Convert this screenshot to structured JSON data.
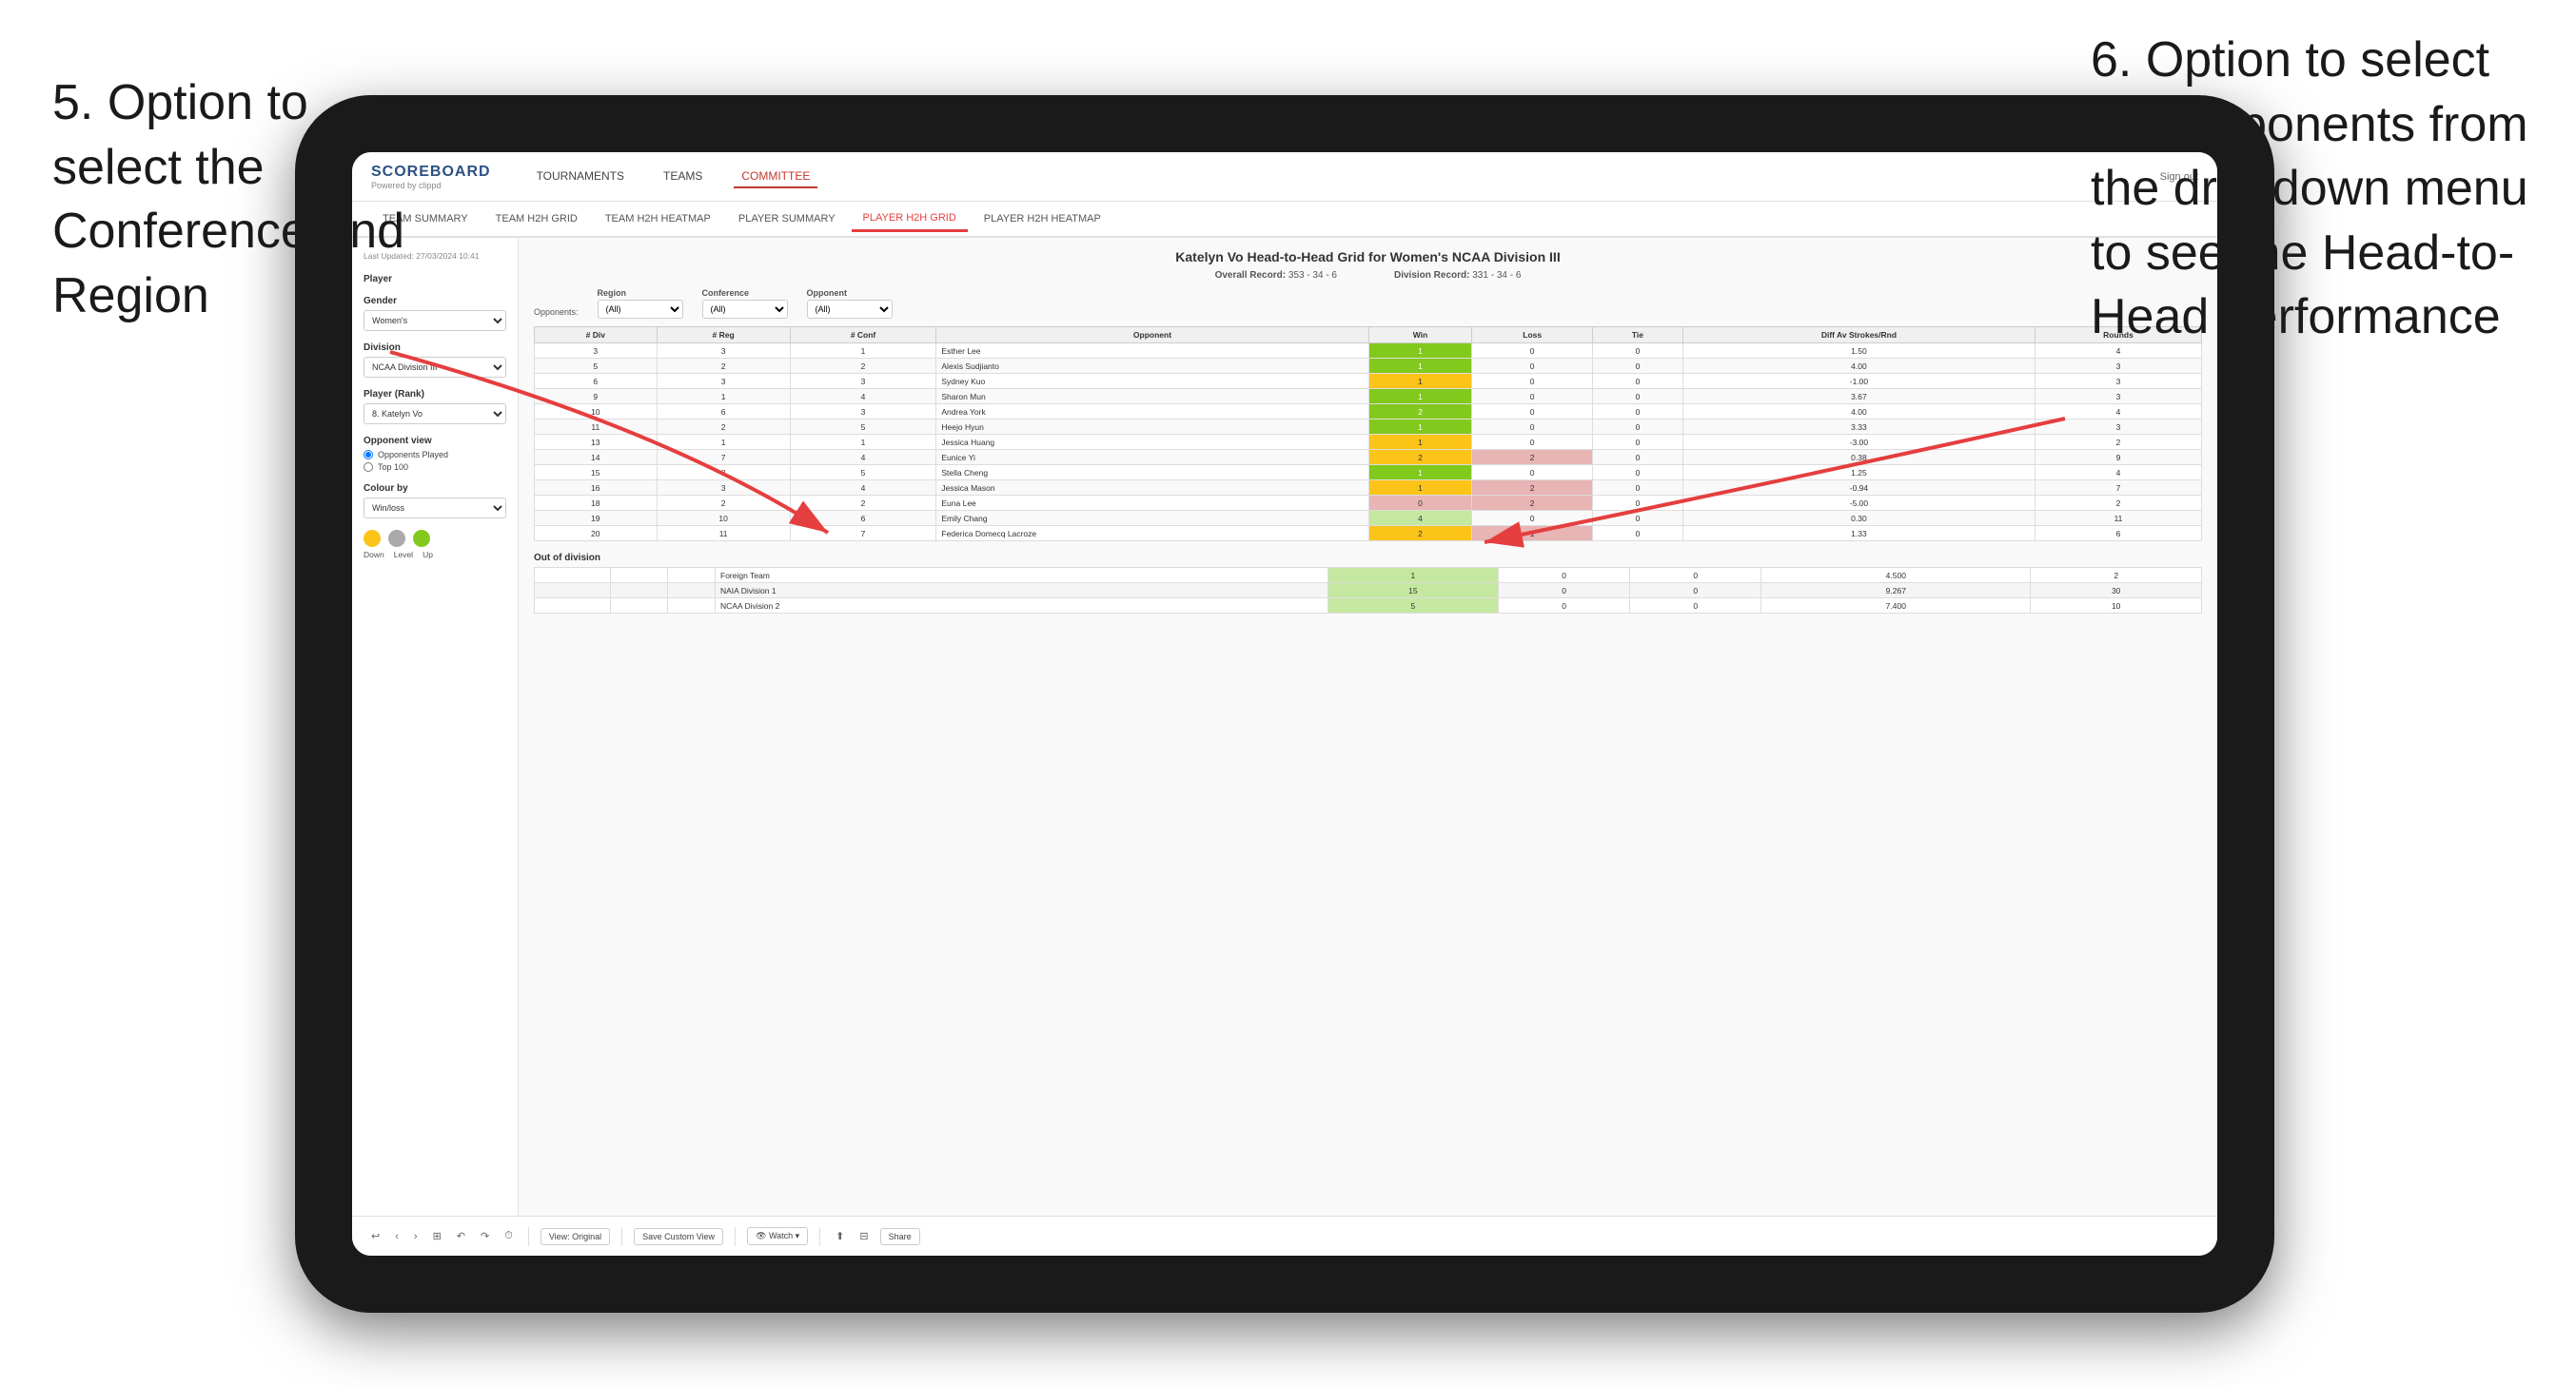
{
  "annotations": {
    "left": {
      "text": "5. Option to select the Conference and Region"
    },
    "right": {
      "text": "6. Option to select the Opponents from the dropdown menu to see the Head-to-Head performance"
    }
  },
  "nav": {
    "logo": "SCOREBOARD",
    "logo_sub": "Powered by clippd",
    "items": [
      "TOURNAMENTS",
      "TEAMS",
      "COMMITTEE"
    ],
    "active": "COMMITTEE",
    "sign_out": "Sign out"
  },
  "sub_nav": {
    "items": [
      "TEAM SUMMARY",
      "TEAM H2H GRID",
      "TEAM H2H HEATMAP",
      "PLAYER SUMMARY",
      "PLAYER H2H GRID",
      "PLAYER H2H HEATMAP"
    ],
    "active": "PLAYER H2H GRID"
  },
  "left_panel": {
    "last_updated": "Last Updated: 27/03/2024 10:41",
    "player_label": "Player",
    "gender_label": "Gender",
    "gender_value": "Women's",
    "division_label": "Division",
    "division_value": "NCAA Division III",
    "player_rank_label": "Player (Rank)",
    "player_rank_value": "8. Katelyn Vo",
    "opponent_view_label": "Opponent view",
    "opponent_options": [
      "Opponents Played",
      "Top 100"
    ],
    "opponent_selected": "Opponents Played",
    "colour_by_label": "Colour by",
    "colour_by_value": "Win/loss",
    "legend": {
      "down": "Down",
      "level": "Level",
      "up": "Up"
    }
  },
  "grid": {
    "title": "Katelyn Vo Head-to-Head Grid for Women's NCAA Division III",
    "overall_record_label": "Overall Record:",
    "overall_record": "353 - 34 - 6",
    "division_record_label": "Division Record:",
    "division_record": "331 - 34 - 6",
    "filters": {
      "region_label": "Region",
      "conference_label": "Conference",
      "opponent_label": "Opponent",
      "opponents_label": "Opponents:",
      "region_value": "(All)",
      "conference_value": "(All)",
      "opponent_value": "(All)"
    },
    "table_headers": [
      "# Div",
      "# Reg",
      "# Conf",
      "Opponent",
      "Win",
      "Loss",
      "Tie",
      "Diff Av Strokes/Rnd",
      "Rounds"
    ],
    "rows": [
      {
        "div": 3,
        "reg": 3,
        "conf": 1,
        "opponent": "Esther Lee",
        "win": 1,
        "loss": 0,
        "tie": 0,
        "diff": 1.5,
        "rounds": 4,
        "win_color": "green"
      },
      {
        "div": 5,
        "reg": 2,
        "conf": 2,
        "opponent": "Alexis Sudjianto",
        "win": 1,
        "loss": 0,
        "tie": 0,
        "diff": 4.0,
        "rounds": 3,
        "win_color": "green"
      },
      {
        "div": 6,
        "reg": 3,
        "conf": 3,
        "opponent": "Sydney Kuo",
        "win": 1,
        "loss": 0,
        "tie": 0,
        "diff": -1.0,
        "rounds": 3,
        "win_color": "yellow"
      },
      {
        "div": 9,
        "reg": 1,
        "conf": 4,
        "opponent": "Sharon Mun",
        "win": 1,
        "loss": 0,
        "tie": 0,
        "diff": 3.67,
        "rounds": 3,
        "win_color": "green"
      },
      {
        "div": 10,
        "reg": 6,
        "conf": 3,
        "opponent": "Andrea York",
        "win": 2,
        "loss": 0,
        "tie": 0,
        "diff": 4.0,
        "rounds": 4,
        "win_color": "green"
      },
      {
        "div": 11,
        "reg": 2,
        "conf": 5,
        "opponent": "Heejo Hyun",
        "win": 1,
        "loss": 0,
        "tie": 0,
        "diff": 3.33,
        "rounds": 3,
        "win_color": "green"
      },
      {
        "div": 13,
        "reg": 1,
        "conf": 1,
        "opponent": "Jessica Huang",
        "win": 1,
        "loss": 0,
        "tie": 0,
        "diff": -3.0,
        "rounds": 2,
        "win_color": "yellow"
      },
      {
        "div": 14,
        "reg": 7,
        "conf": 4,
        "opponent": "Eunice Yi",
        "win": 2,
        "loss": 2,
        "tie": 0,
        "diff": 0.38,
        "rounds": 9,
        "win_color": "yellow"
      },
      {
        "div": 15,
        "reg": 8,
        "conf": 5,
        "opponent": "Stella Cheng",
        "win": 1,
        "loss": 0,
        "tie": 0,
        "diff": 1.25,
        "rounds": 4,
        "win_color": "green"
      },
      {
        "div": 16,
        "reg": 3,
        "conf": 4,
        "opponent": "Jessica Mason",
        "win": 1,
        "loss": 2,
        "tie": 0,
        "diff": -0.94,
        "rounds": 7,
        "win_color": "yellow"
      },
      {
        "div": 18,
        "reg": 2,
        "conf": 2,
        "opponent": "Euna Lee",
        "win": 0,
        "loss": 2,
        "tie": 0,
        "diff": -5.0,
        "rounds": 2,
        "win_color": "red"
      },
      {
        "div": 19,
        "reg": 10,
        "conf": 6,
        "opponent": "Emily Chang",
        "win": 4,
        "loss": 0,
        "tie": 0,
        "diff": 0.3,
        "rounds": 11,
        "win_color": "light-green"
      },
      {
        "div": 20,
        "reg": 11,
        "conf": 7,
        "opponent": "Federica Domecq Lacroze",
        "win": 2,
        "loss": 1,
        "tie": 0,
        "diff": 1.33,
        "rounds": 6,
        "win_color": "yellow"
      }
    ],
    "out_of_division_label": "Out of division",
    "out_of_division_rows": [
      {
        "opponent": "Foreign Team",
        "win": 1,
        "loss": 0,
        "tie": 0,
        "diff": 4.5,
        "rounds": 2
      },
      {
        "opponent": "NAIA Division 1",
        "win": 15,
        "loss": 0,
        "tie": 0,
        "diff": 9.267,
        "rounds": 30
      },
      {
        "opponent": "NCAA Division 2",
        "win": 5,
        "loss": 0,
        "tie": 0,
        "diff": 7.4,
        "rounds": 10
      }
    ]
  },
  "toolbar": {
    "view_original": "View: Original",
    "save_custom": "Save Custom View",
    "watch": "Watch",
    "share": "Share"
  }
}
